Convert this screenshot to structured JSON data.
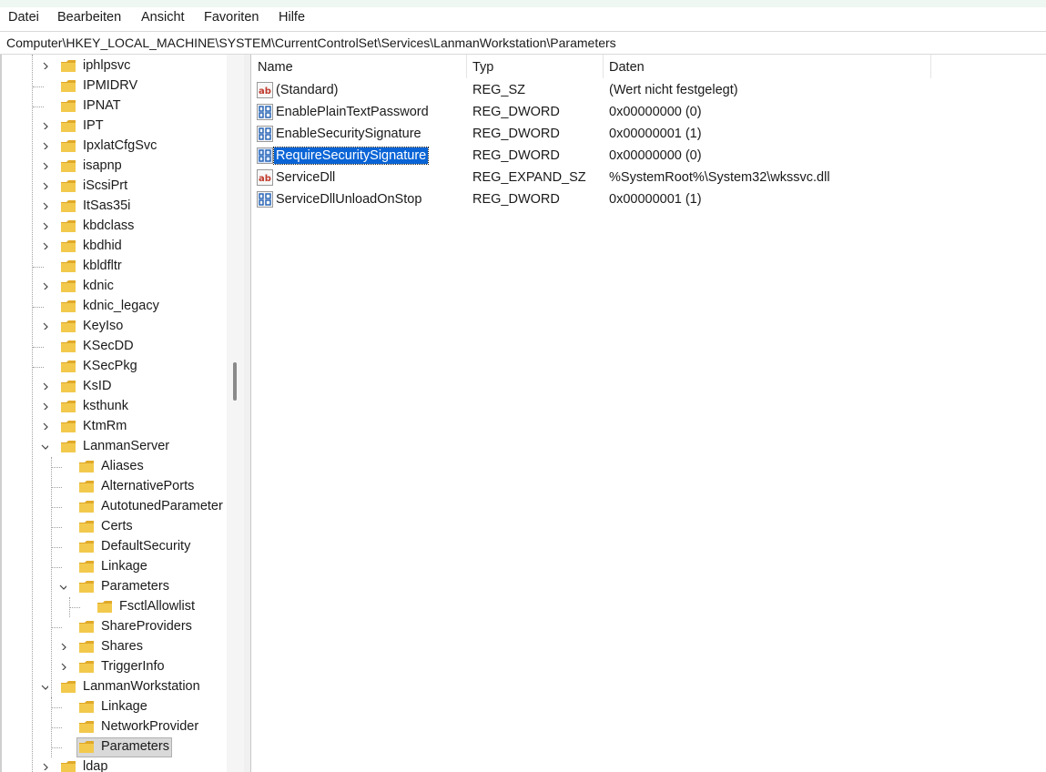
{
  "menu": [
    "Datei",
    "Bearbeiten",
    "Ansicht",
    "Favoriten",
    "Hilfe"
  ],
  "address": "Computer\\HKEY_LOCAL_MACHINE\\SYSTEM\\CurrentControlSet\\Services\\LanmanWorkstation\\Parameters",
  "tree": {
    "items": [
      {
        "label": "iphlpsvc",
        "level": 1,
        "expander": "collapsed"
      },
      {
        "label": "IPMIDRV",
        "level": 1,
        "expander": "none"
      },
      {
        "label": "IPNAT",
        "level": 1,
        "expander": "none"
      },
      {
        "label": "IPT",
        "level": 1,
        "expander": "collapsed"
      },
      {
        "label": "IpxlatCfgSvc",
        "level": 1,
        "expander": "collapsed"
      },
      {
        "label": "isapnp",
        "level": 1,
        "expander": "collapsed"
      },
      {
        "label": "iScsiPrt",
        "level": 1,
        "expander": "collapsed"
      },
      {
        "label": "ItSas35i",
        "level": 1,
        "expander": "collapsed"
      },
      {
        "label": "kbdclass",
        "level": 1,
        "expander": "collapsed"
      },
      {
        "label": "kbdhid",
        "level": 1,
        "expander": "collapsed"
      },
      {
        "label": "kbldfltr",
        "level": 1,
        "expander": "none"
      },
      {
        "label": "kdnic",
        "level": 1,
        "expander": "collapsed"
      },
      {
        "label": "kdnic_legacy",
        "level": 1,
        "expander": "none"
      },
      {
        "label": "KeyIso",
        "level": 1,
        "expander": "collapsed"
      },
      {
        "label": "KSecDD",
        "level": 1,
        "expander": "none"
      },
      {
        "label": "KSecPkg",
        "level": 1,
        "expander": "none"
      },
      {
        "label": "KsID",
        "level": 1,
        "expander": "collapsed"
      },
      {
        "label": "ksthunk",
        "level": 1,
        "expander": "collapsed"
      },
      {
        "label": "KtmRm",
        "level": 1,
        "expander": "collapsed"
      },
      {
        "label": "LanmanServer",
        "level": 1,
        "expander": "expanded"
      },
      {
        "label": "Aliases",
        "level": 2,
        "expander": "none"
      },
      {
        "label": "AlternativePorts",
        "level": 2,
        "expander": "none"
      },
      {
        "label": "AutotunedParameter",
        "level": 2,
        "expander": "none"
      },
      {
        "label": "Certs",
        "level": 2,
        "expander": "none"
      },
      {
        "label": "DefaultSecurity",
        "level": 2,
        "expander": "none"
      },
      {
        "label": "Linkage",
        "level": 2,
        "expander": "none"
      },
      {
        "label": "Parameters",
        "level": 2,
        "expander": "expanded"
      },
      {
        "label": "FsctlAllowlist",
        "level": 3,
        "expander": "none"
      },
      {
        "label": "ShareProviders",
        "level": 2,
        "expander": "none"
      },
      {
        "label": "Shares",
        "level": 2,
        "expander": "collapsed"
      },
      {
        "label": "TriggerInfo",
        "level": 2,
        "expander": "collapsed"
      },
      {
        "label": "LanmanWorkstation",
        "level": 1,
        "expander": "expanded"
      },
      {
        "label": "Linkage",
        "level": 2,
        "expander": "none"
      },
      {
        "label": "NetworkProvider",
        "level": 2,
        "expander": "none"
      },
      {
        "label": "Parameters",
        "level": 2,
        "expander": "none",
        "selected": true
      },
      {
        "label": "ldap",
        "level": 1,
        "expander": "collapsed"
      }
    ]
  },
  "list": {
    "columns": [
      "Name",
      "Typ",
      "Daten"
    ],
    "rows": [
      {
        "icon": "string-value-icon",
        "name": "(Standard)",
        "type": "REG_SZ",
        "data": "(Wert nicht festgelegt)"
      },
      {
        "icon": "binary-value-icon",
        "name": "EnablePlainTextPassword",
        "type": "REG_DWORD",
        "data": "0x00000000 (0)"
      },
      {
        "icon": "binary-value-icon",
        "name": "EnableSecuritySignature",
        "type": "REG_DWORD",
        "data": "0x00000001 (1)"
      },
      {
        "icon": "binary-value-icon",
        "name": "RequireSecuritySignature",
        "type": "REG_DWORD",
        "data": "0x00000000 (0)",
        "selected": true
      },
      {
        "icon": "string-value-icon",
        "name": "ServiceDll",
        "type": "REG_EXPAND_SZ",
        "data": "%SystemRoot%\\System32\\wkssvc.dll"
      },
      {
        "icon": "binary-value-icon",
        "name": "ServiceDllUnloadOnStop",
        "type": "REG_DWORD",
        "data": "0x00000001 (1)"
      }
    ]
  },
  "colors": {
    "selection": "#0a64d6",
    "folder": "#f2c94c",
    "string_icon": "#c0392b",
    "binary_icon": "#1f5fb4"
  }
}
